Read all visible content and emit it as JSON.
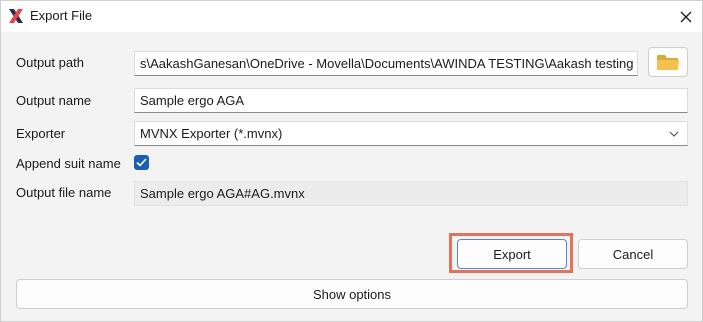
{
  "window": {
    "title": "Export File"
  },
  "form": {
    "output_path": {
      "label": "Output path",
      "value": "s\\AakashGanesan\\OneDrive - Movella\\Documents\\AWINDA TESTING\\Aakash testing"
    },
    "output_name": {
      "label": "Output name",
      "value": "Sample ergo AGA"
    },
    "exporter": {
      "label": "Exporter",
      "value": "MVNX Exporter (*.mvnx)"
    },
    "append_suit_name": {
      "label": "Append suit name",
      "checked": true
    },
    "output_file_name": {
      "label": "Output file name",
      "value": "Sample ergo AGA#AG.mvnx"
    }
  },
  "buttons": {
    "export": "Export",
    "cancel": "Cancel",
    "show_options": "Show options"
  },
  "icons": {
    "app": "app-logo-icon",
    "close": "close-icon",
    "browse": "folder-icon",
    "dropdown": "chevron-down-icon",
    "checkbox": "checkmark-icon"
  },
  "colors": {
    "accent": "#1a5fb4",
    "highlight": "#e0735e",
    "folder": "#f2c14e"
  }
}
